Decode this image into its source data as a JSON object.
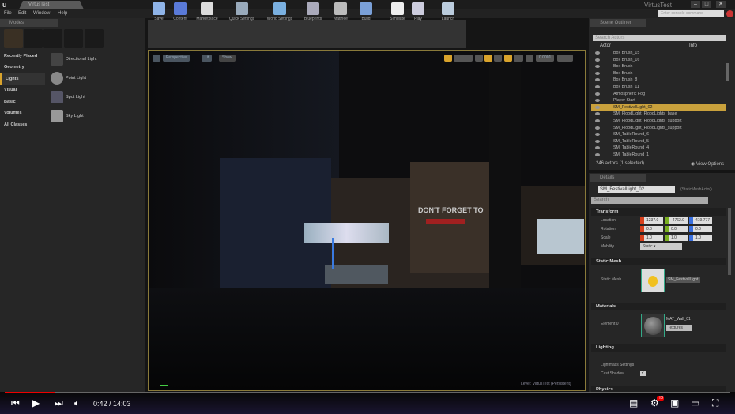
{
  "window": {
    "logo": "u",
    "tab": "VirtusTest",
    "title": "VirtusTest",
    "buttons": [
      "–",
      "□",
      "✕"
    ]
  },
  "menu": [
    "File",
    "Edit",
    "Window",
    "Help"
  ],
  "console": {
    "placeholder": "Enter console command"
  },
  "modes": {
    "tab": "Modes",
    "icons": [
      "place-mode-icon",
      "paint-mode-icon",
      "landscape-mode-icon",
      "foliage-mode-icon",
      "geometry-mode-icon"
    ],
    "categories": [
      "Recently Placed",
      "Geometry",
      "Lights",
      "Visual",
      "Basic",
      "Volumes",
      "All Classes"
    ],
    "selected_category": "Lights",
    "items": [
      "Directional Light",
      "Point Light",
      "Spot Light",
      "Sky Light"
    ]
  },
  "toolbar": [
    {
      "label": "Save",
      "color": "#8fb4e8"
    },
    {
      "label": "Content",
      "color": "#5a7ad8"
    },
    {
      "label": "Marketplace",
      "color": "#ddd"
    },
    {
      "label": "Quick Settings",
      "color": "#9ab"
    },
    {
      "label": "World Settings",
      "color": "#7ab0e0"
    },
    {
      "label": "Blueprints",
      "color": "#aab"
    },
    {
      "label": "Matinee",
      "color": "#bbb"
    },
    {
      "label": "Build",
      "color": "#7aa0d8"
    },
    {
      "label": "Simulate",
      "color": "#eee"
    },
    {
      "label": "Play",
      "color": "#ccd"
    },
    {
      "label": "Launch",
      "color": "#bcd"
    }
  ],
  "viewport": {
    "buttons": [
      "Perspective",
      "Lit",
      "Show"
    ],
    "sign_text": "DON'T FORGET TO",
    "speed": "0.0001",
    "level_label": "Level:  VirtusTest (Persistent)",
    "accent": "#d9a32c"
  },
  "outliner": {
    "tab": "Scene Outliner",
    "search_placeholder": "Search Actors",
    "col_actor": "Actor",
    "col_info": "Info",
    "rows": [
      "Box Brush_15",
      "Box Brush_16",
      "Box Brush",
      "Box Brush",
      "Box Brush_8",
      "Box Brush_11",
      "Atmospheric Fog",
      "Player Start",
      "SM_FestivalLight_02",
      "SM_FloodLight_FloodLights_base",
      "SM_FloodLight_FloodLights_support",
      "SM_FloodLight_FloodLights_support",
      "SM_TableRound_6",
      "SM_TableRound_5",
      "SM_TableRound_4",
      "SM_TableRound_1"
    ],
    "selected": "SM_FestivalLight_02",
    "status": "246 actors (1 selected)",
    "view_options": "View Options"
  },
  "details": {
    "tab": "Details",
    "name": "SM_FestivalLight_02",
    "class": "(StaticMeshActor)",
    "search_placeholder": "Search",
    "transform": {
      "title": "Transform",
      "location_label": "Location",
      "location": [
        "1237.0",
        "-4762.0",
        "419.777"
      ],
      "rotation_label": "Rotation",
      "rotation": [
        "0.0",
        "0.0",
        "0.0"
      ],
      "scale_label": "Scale",
      "scale": [
        "1.0",
        "1.0",
        "1.0"
      ],
      "mobility_label": "Mobility",
      "mobility": "Static"
    },
    "static_mesh": {
      "title": "Static Mesh",
      "label": "Static Mesh",
      "value": "SM_FestivalLight"
    },
    "materials": {
      "title": "Materials",
      "label": "Element 0",
      "value": "MAT_Wall_01",
      "textures": "Textures"
    },
    "lighting": {
      "title": "Lighting",
      "lightmap": "Lightmass Settings",
      "cast_shadow": "Cast Shadow"
    },
    "physics": {
      "title": "Physics"
    }
  },
  "player": {
    "time": "0:42 / 14:03",
    "progress": 0.05
  }
}
